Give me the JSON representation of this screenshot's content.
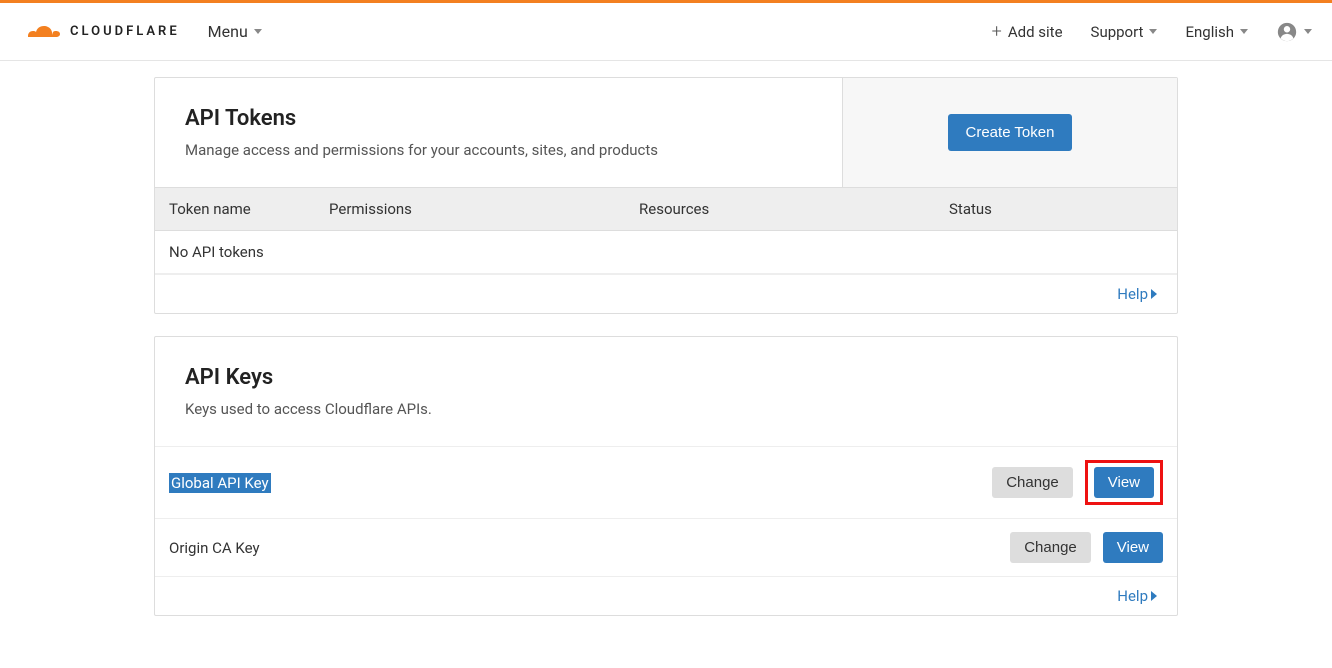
{
  "header": {
    "brand": "CLOUDFLARE",
    "menu": "Menu",
    "add_site": "Add site",
    "support": "Support",
    "language": "English"
  },
  "tokens": {
    "title": "API Tokens",
    "subtitle": "Manage access and permissions for your accounts, sites, and products",
    "create_btn": "Create Token",
    "cols": {
      "name": "Token name",
      "perm": "Permissions",
      "res": "Resources",
      "status": "Status"
    },
    "empty": "No API tokens",
    "help": "Help"
  },
  "keys": {
    "title": "API Keys",
    "subtitle": "Keys used to access Cloudflare APIs.",
    "rows": [
      {
        "name": "Global API Key",
        "change": "Change",
        "view": "View",
        "highlight": true,
        "selected": true
      },
      {
        "name": "Origin CA Key",
        "change": "Change",
        "view": "View",
        "highlight": false,
        "selected": false
      }
    ],
    "help": "Help"
  }
}
